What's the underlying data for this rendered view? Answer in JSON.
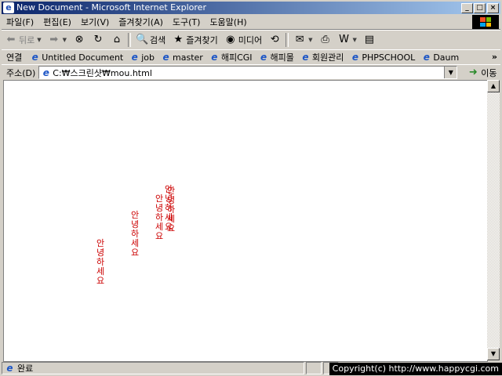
{
  "window": {
    "title": "New Document - Microsoft Internet Explorer",
    "title_icon": "ie-logo-icon",
    "controls": {
      "minimize": "_",
      "maximize": "□",
      "close": "×"
    }
  },
  "menu": {
    "items": [
      "파일(F)",
      "편집(E)",
      "보기(V)",
      "즐겨찾기(A)",
      "도구(T)",
      "도움말(H)"
    ]
  },
  "toolbar": {
    "back_label": "뒤로",
    "search_label": "검색",
    "favorites_label": "즐겨찾기",
    "media_label": "미디어"
  },
  "links": {
    "label": "연결",
    "items": [
      "Untitled Document",
      "job",
      "master",
      "해피CGI",
      "해피몰",
      "회원관리",
      "PHPSCHOOL",
      "Daum"
    ],
    "more": "»"
  },
  "address": {
    "label": "주소(D)",
    "value": "C:₩스크린샷₩mou.html",
    "go_label": "이동"
  },
  "content": {
    "text_color": "#cc0000",
    "vertical_texts": [
      "안녕하세요",
      "안녕하세요",
      "안녕하세요",
      "안녕하세요",
      "안녕하세요"
    ]
  },
  "status": {
    "text": "완료",
    "copyright": "Copyright(c) http://www.happycgi.com"
  }
}
